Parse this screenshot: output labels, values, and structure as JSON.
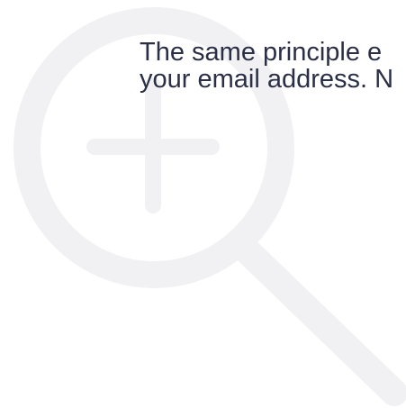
{
  "overlay": {
    "icon": "zoom-in-icon",
    "icon_color": "#f1f1f4"
  },
  "content": {
    "line_1": "The same principle e",
    "line_2": "your email address. N"
  },
  "colors": {
    "text": "#2a2f45",
    "background": "#ffffff"
  }
}
